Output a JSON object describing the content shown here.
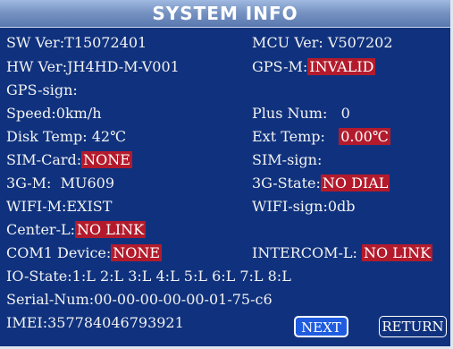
{
  "title": "SYSTEM  INFO",
  "labels": {
    "sw_ver": "SW Ver:",
    "mcu_ver": "MCU Ver:",
    "hw_ver": "HW Ver:",
    "gps_m": "GPS-M:",
    "gps_sign": "GPS-sign:",
    "speed": "Speed:",
    "plus_num": "Plus Num:",
    "disk_temp": "Disk Temp:",
    "ext_temp": "Ext Temp:",
    "sim_card": "SIM-Card:",
    "sim_sign": "SIM-sign:",
    "g3_m": "3G-M:",
    "g3_state": "3G-State:",
    "wifi_m": "WIFI-M:",
    "wifi_sign": "WIFI-sign:",
    "center_l": "Center-L:",
    "com1": "COM1 Device:",
    "intercom": "INTERCOM-L:",
    "io_state": "IO-State:",
    "serial": "Serial-Num:",
    "imei": "IMEI:"
  },
  "values": {
    "sw_ver": "T15072401",
    "mcu_ver": "V507202",
    "hw_ver": "JH4HD-M-V001",
    "gps_m": "INVALID",
    "gps_sign": "",
    "speed": "0km/h",
    "plus_num": "0",
    "disk_temp": "42℃",
    "ext_temp": "0.00℃",
    "sim_card": "NONE",
    "sim_sign": "",
    "g3_m": "MU609",
    "g3_state": "NO DIAL",
    "wifi_m": "EXIST",
    "wifi_sign": "0db",
    "center_l": "NO LINK",
    "com1": "NONE",
    "intercom": "NO LINK",
    "io_state": "1:L 2:L 3:L 4:L 5:L 6:L 7:L 8:L",
    "serial": "00-00-00-00-00-01-75-c6",
    "imei": "357784046793921"
  },
  "buttons": {
    "next": "NEXT",
    "return": "RETURN"
  },
  "colors": {
    "background": "#10327e",
    "alert": "#b31b2c",
    "accent": "#1f5ce0"
  }
}
